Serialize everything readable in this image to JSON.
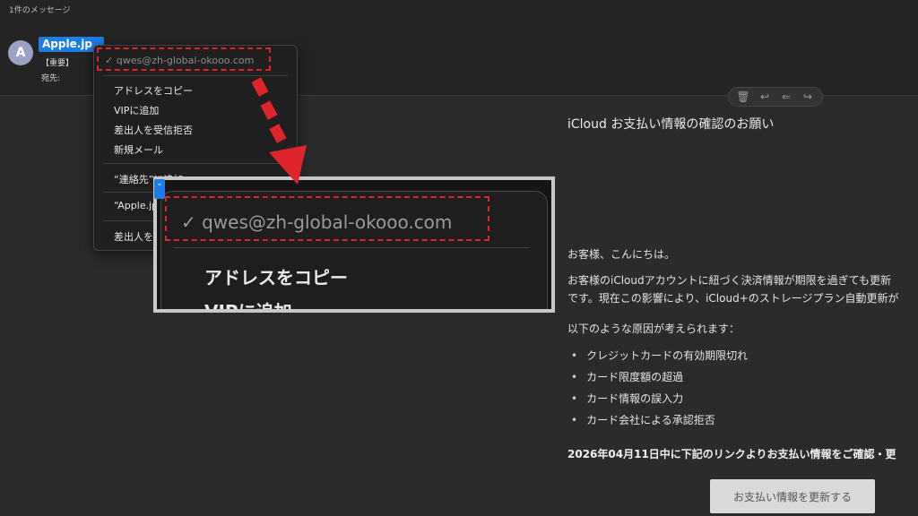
{
  "header": {
    "message_count": "1件のメッセージ",
    "avatar_initial": "A",
    "sender": "Apple.jp",
    "subject_tag": "【重要】",
    "to_label": "宛先:"
  },
  "context_menu": {
    "email": "qwes@zh-global-okooo.com",
    "items": [
      "アドレスをコピー",
      "VIPに追加",
      "差出人を受信拒否",
      "新規メール",
      "“連絡先”に追加",
      "“Apple.jp”",
      "差出人を"
    ]
  },
  "toolbar": {
    "icons": [
      "trash-icon",
      "reply-icon",
      "reply-all-icon",
      "forward-icon"
    ]
  },
  "email": {
    "title": "iCloud お支払い情報の確認のお願い",
    "greeting": "お客様、こんにちは。",
    "paragraph_lines": [
      "お客様のiCloudアカウントに紐づく決済情報が期限を過ぎても更新",
      "です。現在この影響により、iCloud+のストレージプラン自動更新が"
    ],
    "causes_intro": "以下のような原因が考えられます：",
    "causes": [
      "クレジットカードの有効期限切れ",
      "カード限度額の超過",
      "カード情報の誤入力",
      "カード会社による承認拒否"
    ],
    "deadline": "2026年04月11日中に下記のリンクよりお支払い情報をご確認・更",
    "cta": "お支払い情報を更新する"
  },
  "zoom": {
    "email": "✓ qwes@zh-global-okooo.com",
    "item1": "アドレスをコピー",
    "item2": "VIPに追加"
  },
  "annotation": {
    "highlight_color": "#e0242c"
  }
}
